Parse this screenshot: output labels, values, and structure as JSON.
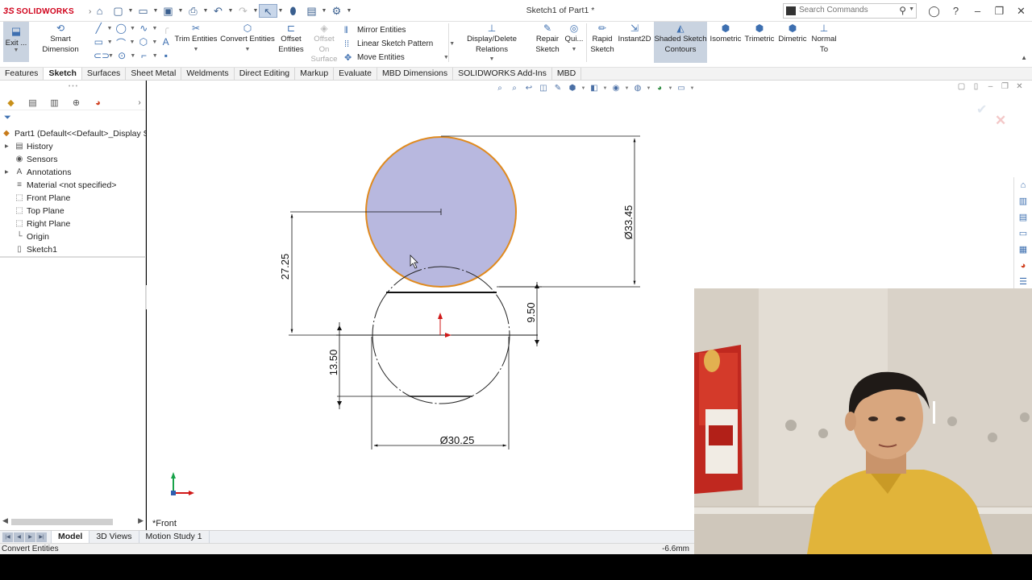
{
  "app": {
    "brand_prefix": "3S",
    "brand": "SOLIDWORKS",
    "doc_title": "Sketch1 of Part1 *"
  },
  "search": {
    "placeholder": "Search Commands"
  },
  "ribbon": {
    "exit_label": "Exit ...",
    "smart_dimension": "Smart Dimension",
    "trim_entities": "Trim Entities",
    "convert_entities": "Convert Entities",
    "offset_entities": "Offset Entities",
    "offset_on_surface": "Offset On Surface",
    "mirror_entities": "Mirror Entities",
    "linear_sketch_pattern": "Linear Sketch Pattern",
    "move_entities": "Move Entities",
    "display_delete_relations": "Display/Delete Relations",
    "repair_sketch": "Repair Sketch",
    "quick_snaps": "Qui...",
    "rapid_sketch": "Rapid Sketch",
    "instant2d": "Instant2D",
    "shaded_sketch_contours": "Shaded Sketch Contours",
    "isometric": "Isometric",
    "trimetric": "Trimetric",
    "dimetric": "Dimetric",
    "normal_to": "Normal To"
  },
  "cm_tabs": [
    "Features",
    "Sketch",
    "Surfaces",
    "Sheet Metal",
    "Weldments",
    "Direct Editing",
    "Markup",
    "Evaluate",
    "MBD Dimensions",
    "SOLIDWORKS Add-Ins",
    "MBD"
  ],
  "cm_active": "Sketch",
  "tree": {
    "root": "Part1  (Default<<Default>_Display S",
    "items": [
      "History",
      "Sensors",
      "Annotations",
      "Material <not specified>",
      "Front Plane",
      "Top Plane",
      "Right Plane",
      "Origin",
      "Sketch1"
    ]
  },
  "sketch": {
    "dims": {
      "top_diameter": "Ø33.45",
      "left_height": "27.25",
      "gap": "9.50",
      "lower_height": "13.50",
      "bottom_diameter": "Ø30.25"
    },
    "colors": {
      "fill": "#b8b8df",
      "outline": "#e08a1e",
      "line": "#222222"
    }
  },
  "view_label": "*Front",
  "bottom_tabs": [
    "Model",
    "3D Views",
    "Motion Study 1"
  ],
  "bottom_active": "Model",
  "status": {
    "message": "Convert Entities",
    "coord": "-6.6mm"
  }
}
